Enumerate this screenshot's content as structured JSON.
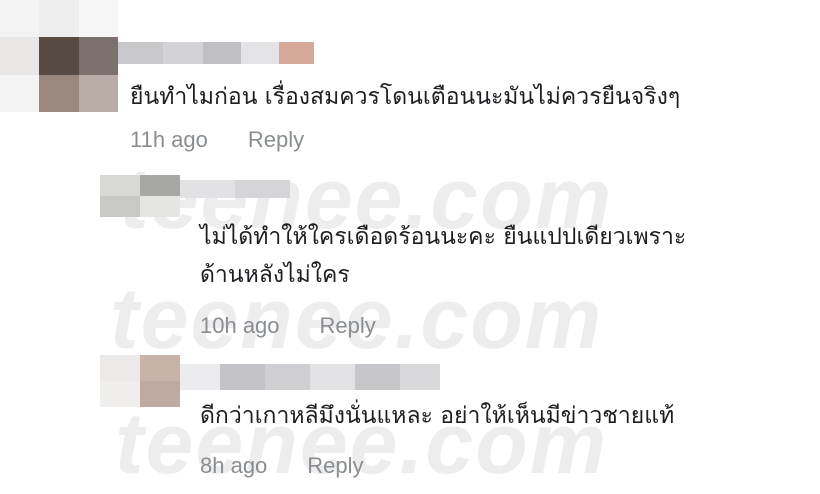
{
  "watermark": "teenee.com",
  "comments": [
    {
      "name_partial": "",
      "text_lines": [
        "ยืนทำไมก่อน เรื่องสมควรโดนเตือนนะมันไม่ควรยืนจริงๆ"
      ],
      "time": "11h ago",
      "reply_label": "Reply"
    },
    {
      "name_partial": "",
      "text_lines": [
        "ไม่ได้ทำให้ใครเดือดร้อนนะคะ ยืนแปปเดียวเพราะ",
        "ด้านหลังไม่ใคร"
      ],
      "time": "10h ago",
      "reply_label": "Reply"
    },
    {
      "name_partial": "",
      "text_lines": [
        "ดีกว่าเกาหลีมึงนั่นแหละ อย่าให้เห็นมีข่าวชายแท้"
      ],
      "time": "8h ago",
      "reply_label": "Reply"
    }
  ]
}
